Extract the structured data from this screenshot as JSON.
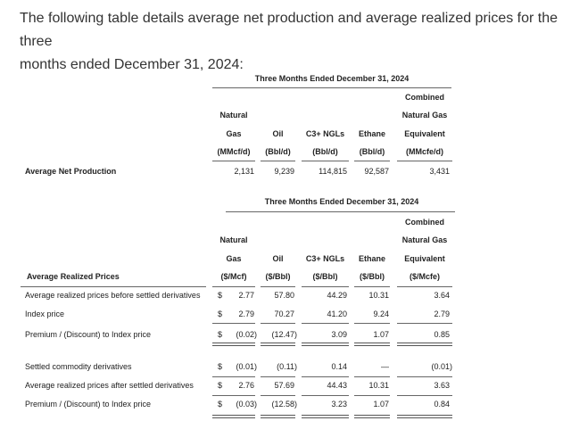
{
  "intro": {
    "line1": "The following table details average net production and average realized prices for the three",
    "line2": "months ended December 31, 2024:"
  },
  "production_table": {
    "period_header": "Three Months Ended December 31, 2024",
    "columns": [
      {
        "lines": [
          "Natural",
          "Gas",
          "(MMcf/d)"
        ]
      },
      {
        "lines": [
          "Oil",
          "(Bbl/d)"
        ]
      },
      {
        "lines": [
          "C3+ NGLs",
          "(Bbl/d)"
        ]
      },
      {
        "lines": [
          "Ethane",
          "(Bbl/d)"
        ]
      },
      {
        "lines": [
          "Combined",
          "Natural Gas",
          "Equivalent",
          "(MMcfe/d)"
        ]
      }
    ],
    "rows": [
      {
        "label": "Average Net Production",
        "values": [
          "2,131",
          "9,239",
          "114,815",
          "92,587",
          "3,431"
        ]
      }
    ]
  },
  "prices_table": {
    "period_header": "Three Months Ended December 31, 2024",
    "row_header": "Average Realized Prices",
    "currency_symbol": "$",
    "columns": [
      {
        "lines": [
          "Natural",
          "Gas",
          "($/Mcf)"
        ]
      },
      {
        "lines": [
          "Oil",
          "($/Bbl)"
        ]
      },
      {
        "lines": [
          "C3+ NGLs",
          "($/Bbl)"
        ]
      },
      {
        "lines": [
          "Ethane",
          "($/Bbl)"
        ]
      },
      {
        "lines": [
          "Combined",
          "Natural Gas",
          "Equivalent",
          "($/Mcfe)"
        ]
      }
    ],
    "rows": [
      {
        "label": "Average realized prices before settled derivatives",
        "dollar": true,
        "values": [
          "2.77",
          "57.80",
          "44.29",
          "10.31",
          "3.64"
        ]
      },
      {
        "label": "Index price",
        "dollar": true,
        "values": [
          "2.79",
          "70.27",
          "41.20",
          "9.24",
          "2.79"
        ]
      },
      {
        "label": "Premium / (Discount) to Index price",
        "dollar": true,
        "values": [
          "(0.02)",
          "(12.47)",
          "3.09",
          "1.07",
          "0.85"
        ]
      },
      {
        "label": "Settled commodity derivatives",
        "dollar": true,
        "values": [
          "(0.01)",
          "(0.11)",
          "0.14",
          "—",
          "(0.01)"
        ]
      },
      {
        "label": "Average realized prices after settled derivatives",
        "dollar": true,
        "values": [
          "2.76",
          "57.69",
          "44.43",
          "10.31",
          "3.63"
        ]
      },
      {
        "label": "Premium / (Discount) to Index price",
        "dollar": true,
        "values": [
          "(0.03)",
          "(12.58)",
          "3.23",
          "1.07",
          "0.84"
        ]
      }
    ]
  }
}
